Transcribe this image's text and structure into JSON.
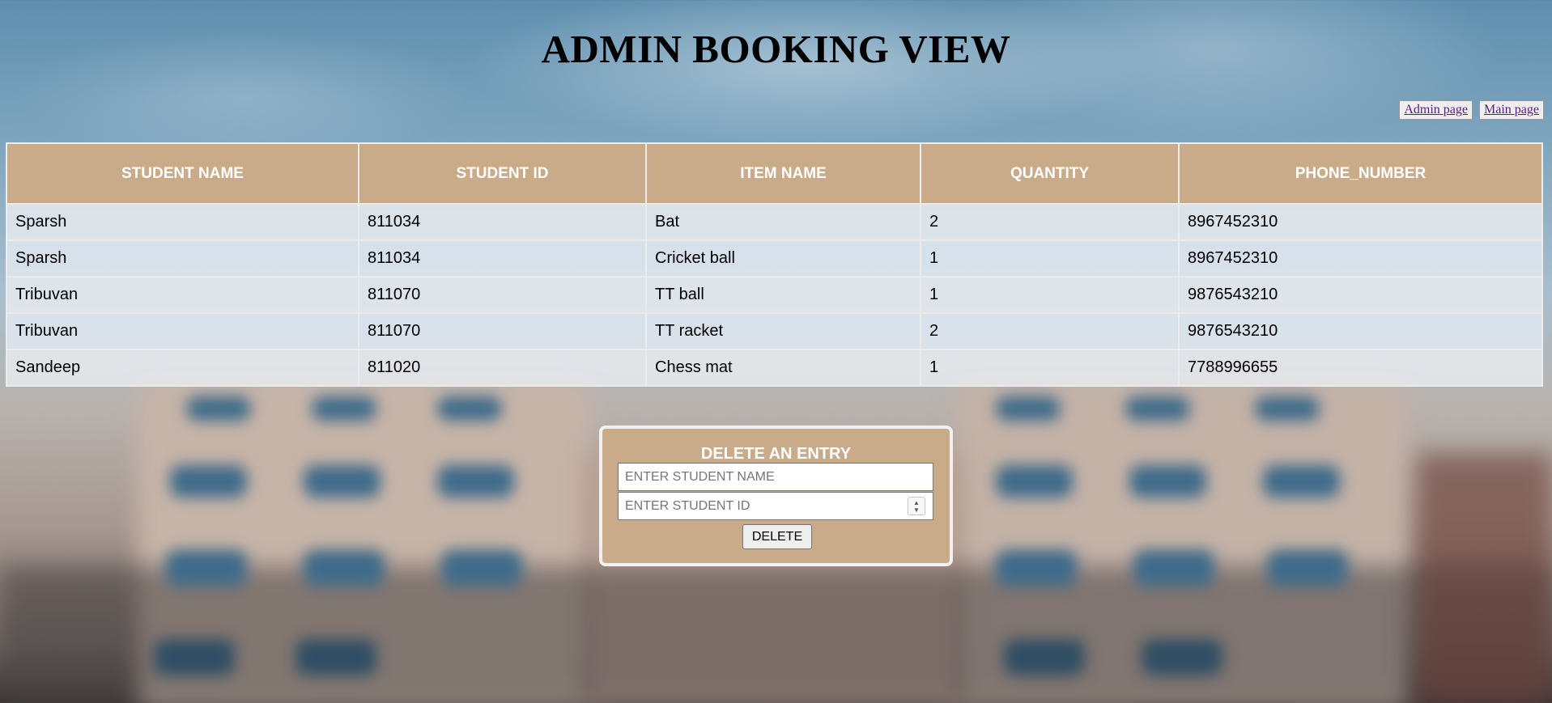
{
  "page": {
    "title": "ADMIN BOOKING VIEW"
  },
  "nav": {
    "admin_page": "Admin page",
    "main_page": "Main page"
  },
  "table": {
    "headers": [
      "STUDENT NAME",
      "STUDENT ID",
      "ITEM NAME",
      "QUANTITY",
      "PHONE_NUMBER"
    ],
    "rows": [
      [
        "Sparsh",
        "811034",
        "Bat",
        "2",
        "8967452310"
      ],
      [
        "Sparsh",
        "811034",
        "Cricket ball",
        "1",
        "8967452310"
      ],
      [
        "Tribuvan",
        "811070",
        "TT ball",
        "1",
        "9876543210"
      ],
      [
        "Tribuvan",
        "811070",
        "TT racket",
        "2",
        "9876543210"
      ],
      [
        "Sandeep",
        "811020",
        "Chess mat",
        "1",
        "7788996655"
      ]
    ]
  },
  "delete_form": {
    "title": "DELETE AN ENTRY",
    "name_placeholder": "ENTER STUDENT NAME",
    "id_placeholder": "ENTER STUDENT ID",
    "button": "DELETE"
  },
  "colors": {
    "header_bg": "#c9ab8a",
    "form_bg": "#c9ab8a",
    "link": "#551a8b"
  }
}
